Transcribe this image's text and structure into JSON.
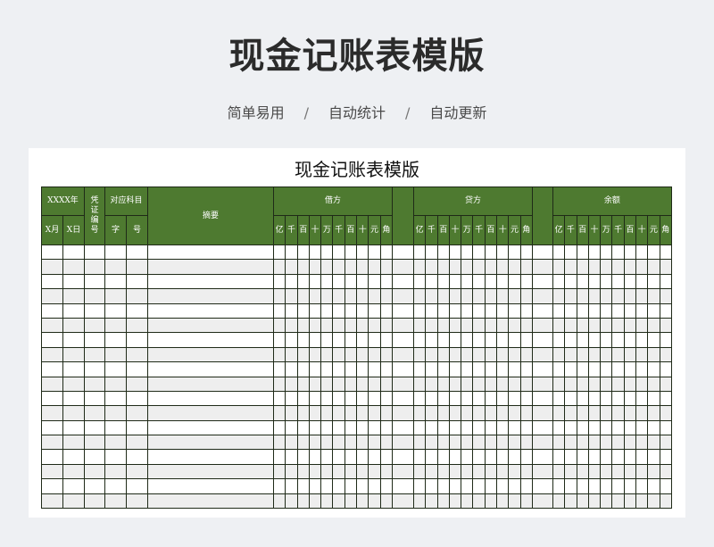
{
  "hero": {
    "title": "现金记账表模版",
    "tags": [
      "简单易用",
      "自动统计",
      "自动更新"
    ],
    "separator": "/"
  },
  "sheet": {
    "title": "现金记账表模版",
    "headers": {
      "date_group": "XXXX年",
      "month": "X月",
      "day": "X日",
      "voucher_no": "凭证编号",
      "account_group": "对应科目",
      "account_char": "字",
      "account_no": "号",
      "summary": "摘要",
      "debit": "借方",
      "credit": "贷方",
      "balance": "余额"
    },
    "digit_units": [
      "亿",
      "千",
      "百",
      "十",
      "万",
      "千",
      "百",
      "十",
      "元",
      "角"
    ],
    "empty_rows": 18
  },
  "colors": {
    "header_bg": "#4e7a30",
    "header_text": "#ffffff",
    "stripe": "#eeeeee",
    "page_bg": "#eef0f3"
  }
}
